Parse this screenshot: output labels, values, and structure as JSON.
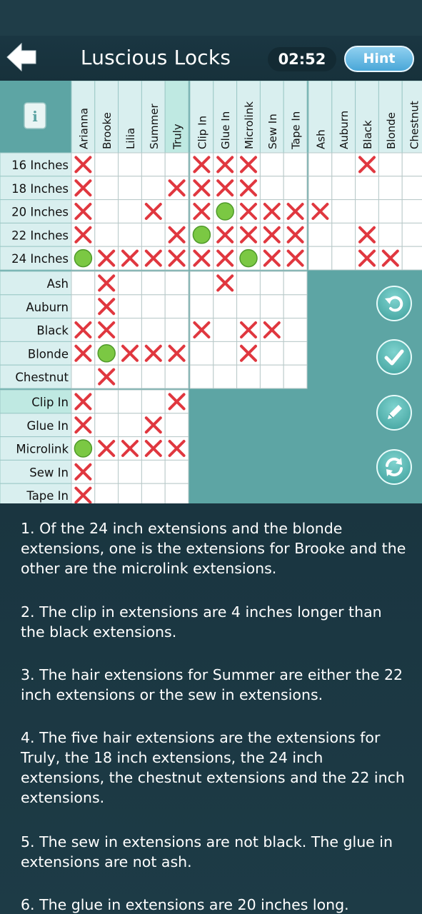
{
  "header": {
    "title": "Luscious Locks",
    "timer": "02:52",
    "hint_label": "Hint",
    "back_icon": "back-arrow-icon"
  },
  "colors": {
    "grid_teal": "#5da5a4",
    "label_light": "#d9efef",
    "label_highlight": "#bfe9e2",
    "cross_red": "#e0373f",
    "circle_green": "#7bc843",
    "button_blue": "#4aa7d8"
  },
  "grid": {
    "info_label": "i",
    "column_groups": [
      [
        "Arianna",
        "Brooke",
        "Lilia",
        "Summer",
        "Truly"
      ],
      [
        "Clip In",
        "Glue In",
        "Microlink",
        "Sew In",
        "Tape In"
      ],
      [
        "Ash",
        "Auburn",
        "Black",
        "Blonde",
        "Chestnut"
      ]
    ],
    "row_groups": [
      [
        "16 Inches",
        "18 Inches",
        "20 Inches",
        "22 Inches",
        "24 Inches"
      ],
      [
        "Ash",
        "Auburn",
        "Black",
        "Blonde",
        "Chestnut"
      ],
      [
        "Clip In",
        "Glue In",
        "Microlink",
        "Sew In",
        "Tape In"
      ]
    ],
    "blocks": [
      {
        "row_group": 0,
        "col_group": 0,
        "cells": [
          [
            "X",
            "",
            "",
            "",
            ""
          ],
          [
            "X",
            "",
            "",
            "",
            "X"
          ],
          [
            "X",
            "",
            "",
            "X",
            ""
          ],
          [
            "X",
            "",
            "",
            "",
            "X"
          ],
          [
            "O",
            "X",
            "X",
            "X",
            "X"
          ]
        ]
      },
      {
        "row_group": 0,
        "col_group": 1,
        "cells": [
          [
            "X",
            "X",
            "X",
            "",
            ""
          ],
          [
            "X",
            "X",
            "X",
            "",
            ""
          ],
          [
            "X",
            "O",
            "X",
            "X",
            "X"
          ],
          [
            "O",
            "X",
            "X",
            "X",
            "X"
          ],
          [
            "X",
            "X",
            "O",
            "X",
            "X"
          ]
        ]
      },
      {
        "row_group": 0,
        "col_group": 2,
        "cells": [
          [
            "",
            "",
            "X",
            "",
            ""
          ],
          [
            "",
            "",
            "",
            "",
            ""
          ],
          [
            "X",
            "",
            "",
            "",
            ""
          ],
          [
            "",
            "",
            "X",
            "",
            ""
          ],
          [
            "",
            "",
            "X",
            "X",
            ""
          ]
        ]
      },
      {
        "row_group": 1,
        "col_group": 0,
        "cells": [
          [
            "",
            "X",
            "",
            "",
            ""
          ],
          [
            "",
            "X",
            "",
            "",
            ""
          ],
          [
            "X",
            "X",
            "",
            "",
            ""
          ],
          [
            "X",
            "O",
            "X",
            "X",
            "X"
          ],
          [
            "",
            "X",
            "",
            "",
            ""
          ]
        ]
      },
      {
        "row_group": 1,
        "col_group": 1,
        "cells": [
          [
            "",
            "X",
            "",
            "",
            ""
          ],
          [
            "",
            "",
            "",
            "",
            ""
          ],
          [
            "X",
            "",
            "X",
            "X",
            ""
          ],
          [
            "",
            "",
            "X",
            "",
            ""
          ],
          [
            "",
            "",
            "",
            "",
            ""
          ]
        ]
      },
      {
        "row_group": 2,
        "col_group": 0,
        "cells": [
          [
            "X",
            "",
            "",
            "",
            "X"
          ],
          [
            "X",
            "",
            "",
            "X",
            ""
          ],
          [
            "O",
            "X",
            "X",
            "X",
            "X"
          ],
          [
            "X",
            "",
            "",
            "",
            ""
          ],
          [
            "X",
            "",
            "",
            "",
            ""
          ]
        ]
      }
    ],
    "highlight": {
      "col_group": 0,
      "col": 4,
      "row_group": 2,
      "row": 0
    }
  },
  "side_buttons": [
    {
      "name": "undo-button",
      "icon": "undo-icon"
    },
    {
      "name": "check-button",
      "icon": "check-icon"
    },
    {
      "name": "pencil-button",
      "icon": "pencil-icon"
    },
    {
      "name": "reset-button",
      "icon": "refresh-icon"
    }
  ],
  "clues": [
    "1. Of the 24 inch extensions and the blonde extensions, one is the extensions for Brooke and the other are the microlink extensions.",
    "2. The clip in extensions are 4 inches longer than the black extensions.",
    "3. The hair extensions for Summer are either the 22 inch extensions or the sew in extensions.",
    "4. The five hair extensions are the extensions for Truly, the 18 inch extensions, the 24 inch extensions, the chestnut extensions and the 22 inch extensions.",
    "5. The sew in extensions are not black. The glue in extensions are not ash.",
    "6. The glue in extensions are 20 inches long."
  ]
}
